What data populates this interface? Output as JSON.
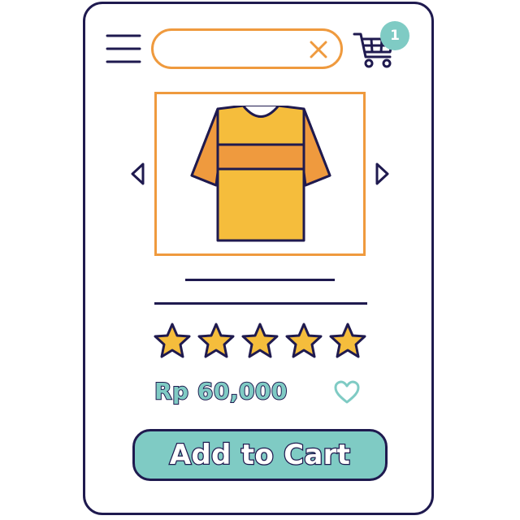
{
  "header": {
    "menu_icon": "hamburger-menu-icon",
    "search": {
      "value": "",
      "placeholder": "",
      "clear_icon": "close-icon"
    },
    "cart": {
      "icon": "shopping-cart-icon",
      "badge_count": "1"
    }
  },
  "product": {
    "image_icon": "t-shirt-icon",
    "nav": {
      "prev_icon": "triangle-left-icon",
      "next_icon": "triangle-right-icon"
    },
    "rating": {
      "stars": 5,
      "max": 5
    },
    "price": "Rp 60,000",
    "favorite_icon": "heart-outline-icon"
  },
  "actions": {
    "add_to_cart_label": "Add to Cart"
  },
  "colors": {
    "outline": "#1f1a4f",
    "accent_orange": "#ef9a3e",
    "accent_teal": "#7fcbc4",
    "shirt_yellow": "#f5bd3c",
    "star_yellow": "#f5bd3c"
  }
}
